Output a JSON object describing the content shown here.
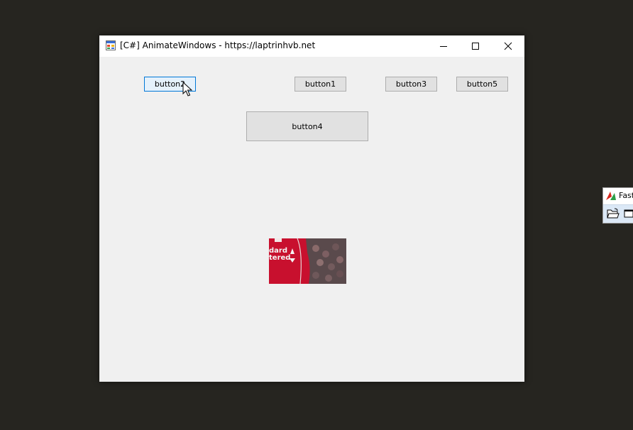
{
  "window": {
    "title": "[C#] AnimateWindows - https://laptrinhvb.net",
    "icons": {
      "app": "winforms-app-icon",
      "minimize": "minimize-icon",
      "maximize": "maximize-icon",
      "close": "close-icon"
    }
  },
  "buttons": {
    "button1": "button1",
    "button2": "button2",
    "button3": "button3",
    "button4": "button4",
    "button5": "button5"
  },
  "focused_button": "button2",
  "picture": {
    "icon": "football-jersey-photo",
    "fragments": [
      "dard",
      "tered"
    ]
  },
  "second_window": {
    "title": "Fast",
    "icons": {
      "app": "fast-app-icon",
      "open": "open-folder-icon",
      "window": "window-icon"
    }
  },
  "colors": {
    "desktop": "#262520",
    "client": "#f0f0f0",
    "focus_border": "#0078d7",
    "button_face": "#e1e1e1",
    "jersey_red": "#c8102e"
  }
}
